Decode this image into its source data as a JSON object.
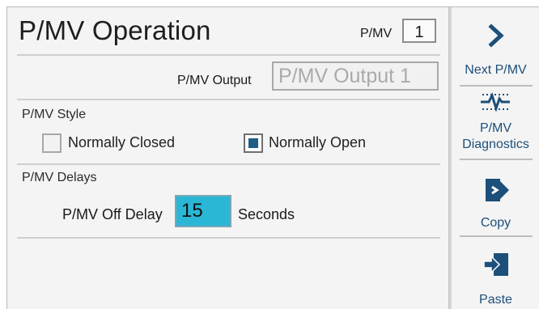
{
  "header": {
    "title": "P/MV Operation",
    "pmv_label": "P/MV",
    "pmv_number": "1"
  },
  "output": {
    "label": "P/MV Output",
    "value": "P/MV Output 1"
  },
  "style": {
    "section_title": "P/MV Style",
    "options": [
      {
        "label": "Normally Closed",
        "checked": false
      },
      {
        "label": "Normally Open",
        "checked": true
      }
    ]
  },
  "delays": {
    "section_title": "P/MV Delays",
    "off_delay_label": "P/MV Off Delay",
    "off_delay_value": "15",
    "unit": "Seconds"
  },
  "sidebar": {
    "buttons": [
      {
        "label": "Next P/MV",
        "icon": "chevron-right-icon"
      },
      {
        "label_line1": "P/MV",
        "label_line2": "Diagnostics",
        "icon": "diagnostics-icon"
      },
      {
        "label": "Copy",
        "icon": "copy-icon"
      },
      {
        "label": "Paste",
        "icon": "paste-icon"
      }
    ]
  },
  "colors": {
    "accent_blue": "#1c4f7a",
    "field_highlight": "#2ab7d6",
    "checkbox_fill": "#1f5d86"
  }
}
